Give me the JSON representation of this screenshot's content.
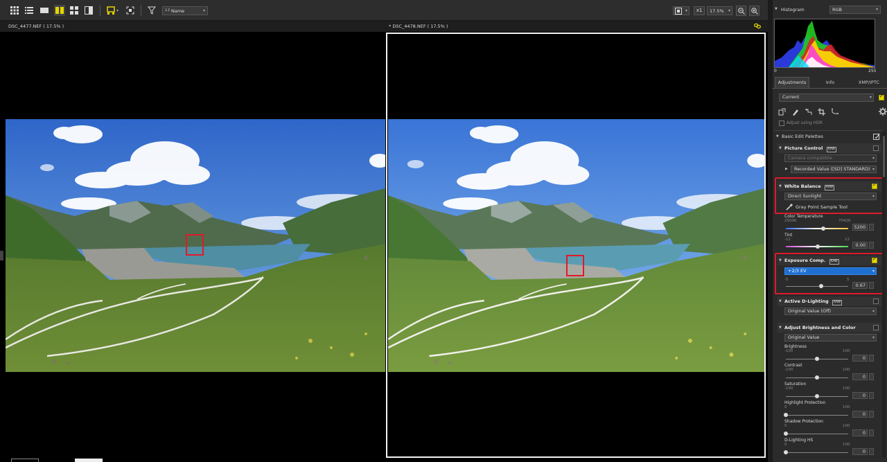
{
  "toolbar": {
    "sort_label": "Name",
    "zoom_x1": "x1",
    "zoom_value": "17.5%"
  },
  "viewer": {
    "left_title": "DSC_4477.NEF ( 17.5% )",
    "right_title": "* DSC_4478.NEF ( 17.5% )"
  },
  "histogram": {
    "title": "Histogram",
    "channel": "RGB",
    "min": "0",
    "max": "255"
  },
  "tabs": [
    "Adjustments",
    "Info",
    "XMP/IPTC"
  ],
  "adjust": {
    "preset": "Current",
    "hdr_label": "Adjust using HDR",
    "palettes_title": "Basic Edit Palettes",
    "picture_control": {
      "title": "Picture Control",
      "raw_badge": "RAW",
      "mode": "Camera compatible",
      "value": "Recorded Value ([SD] STANDARD)"
    },
    "white_balance": {
      "title": "White Balance",
      "raw_badge": "RAW",
      "value": "Direct Sunlight",
      "tool": "Gray Point Sample Tool",
      "temp_label": "Color Temperature",
      "temp_min": "2500K",
      "temp_max": "7042K",
      "temp_value": "5200",
      "tint_label": "Tint",
      "tint_min": "-12",
      "tint_max": "12",
      "tint_value": "0.00"
    },
    "exposure": {
      "title": "Exposure Comp.",
      "raw_badge": "RAW",
      "value": "+2/3 EV",
      "min": "-5",
      "max": "5",
      "number": "0.67"
    },
    "adl": {
      "title": "Active D-Lighting",
      "raw_badge": "RAW",
      "value": "Original Value (Off)"
    },
    "brightness_color": {
      "title": "Adjust Brightness and Color",
      "value": "Original Value",
      "sliders": [
        {
          "label": "Brightness",
          "min": "-100",
          "max": "100",
          "value": "0"
        },
        {
          "label": "Contrast",
          "min": "-100",
          "max": "100",
          "value": "0"
        },
        {
          "label": "Saturation",
          "min": "-100",
          "max": "100",
          "value": "0"
        },
        {
          "label": "Highlight Protection",
          "min": "0",
          "max": "100",
          "value": "0"
        },
        {
          "label": "Shadow Protection",
          "min": "0",
          "max": "100",
          "value": "0"
        },
        {
          "label": "D-Lighting HS",
          "min": "0",
          "max": "100",
          "value": "0"
        }
      ]
    }
  },
  "colors": {
    "accent_yellow": "#e5d600",
    "highlight_red": "#e0192a",
    "selection_blue": "#1f6fd1"
  }
}
